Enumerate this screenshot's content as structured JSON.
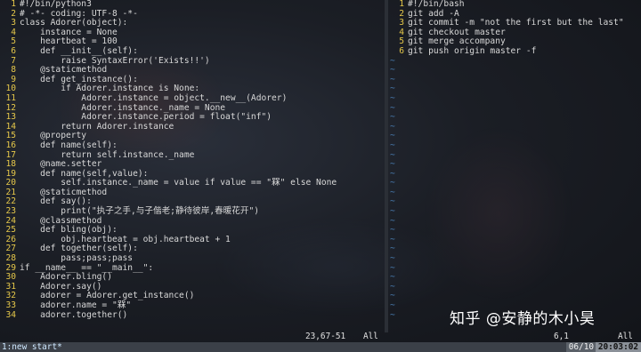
{
  "left_pane": {
    "lines": [
      {
        "n": "1",
        "t": "#!/bin/python3"
      },
      {
        "n": "2",
        "t": "# -*- coding: UTF-8 -*-"
      },
      {
        "n": "3",
        "t": "class Adorer(object):"
      },
      {
        "n": "4",
        "t": "    instance = None"
      },
      {
        "n": "5",
        "t": "    heartbeat = 100"
      },
      {
        "n": "6",
        "t": "    def __init__(self):"
      },
      {
        "n": "7",
        "t": "        raise SyntaxError('Exists!!')"
      },
      {
        "n": "8",
        "t": "    @staticmethod"
      },
      {
        "n": "9",
        "t": "    def get_instance():"
      },
      {
        "n": "10",
        "t": "        if Adorer.instance is None:"
      },
      {
        "n": "11",
        "t": "            Adorer.instance = object.__new__(Adorer)"
      },
      {
        "n": "12",
        "t": "            Adorer.instance._name = None"
      },
      {
        "n": "13",
        "t": "            Adorer.instance.period = float(\"inf\")"
      },
      {
        "n": "14",
        "t": "        return Adorer.instance"
      },
      {
        "n": "15",
        "t": "    @property"
      },
      {
        "n": "16",
        "t": "    def name(self):"
      },
      {
        "n": "17",
        "t": "        return self.instance._name"
      },
      {
        "n": "18",
        "t": "    @name.setter"
      },
      {
        "n": "19",
        "t": "    def name(self,value):"
      },
      {
        "n": "20",
        "t": "        self.instance._name = value if value == \"槑\" else None"
      },
      {
        "n": "21",
        "t": "    @staticmethod"
      },
      {
        "n": "22",
        "t": "    def say():"
      },
      {
        "n": "23",
        "t": "        print(\"执子之手,与子偕老;静待彼岸,春暖花开\")"
      },
      {
        "n": "24",
        "t": "    @classmethod"
      },
      {
        "n": "25",
        "t": "    def bling(obj):"
      },
      {
        "n": "26",
        "t": "        obj.heartbeat = obj.heartbeat + 1"
      },
      {
        "n": "27",
        "t": "    def together(self):"
      },
      {
        "n": "28",
        "t": "        pass;pass;pass"
      },
      {
        "n": "29",
        "t": "if __name__ == \"__main__\":"
      },
      {
        "n": "30",
        "t": "    Adorer.bling()"
      },
      {
        "n": "31",
        "t": "    Adorer.say()"
      },
      {
        "n": "32",
        "t": "    adorer = Adorer.get_instance()"
      },
      {
        "n": "33",
        "t": "    adorer.name = \"槑\""
      },
      {
        "n": "34",
        "t": "    adorer.together()"
      }
    ],
    "status_pos": "23,67-51",
    "status_all": "All"
  },
  "right_pane": {
    "lines": [
      {
        "n": "1",
        "t": "#!/bin/bash"
      },
      {
        "n": "2",
        "t": "git add -A"
      },
      {
        "n": "3",
        "t": "git commit -m \"not the first but the last\""
      },
      {
        "n": "4",
        "t": "git checkout master"
      },
      {
        "n": "5",
        "t": "git merge accompany"
      },
      {
        "n": "6",
        "t": "git push origin master -f"
      }
    ],
    "tilde_count": 28,
    "tilde": "~",
    "status_pos": "6,1",
    "status_all": "All"
  },
  "tmux": {
    "window": "1:new start*",
    "date": "06/10",
    "time": "20:03:02"
  },
  "watermark": "知乎 @安静的木小昊"
}
